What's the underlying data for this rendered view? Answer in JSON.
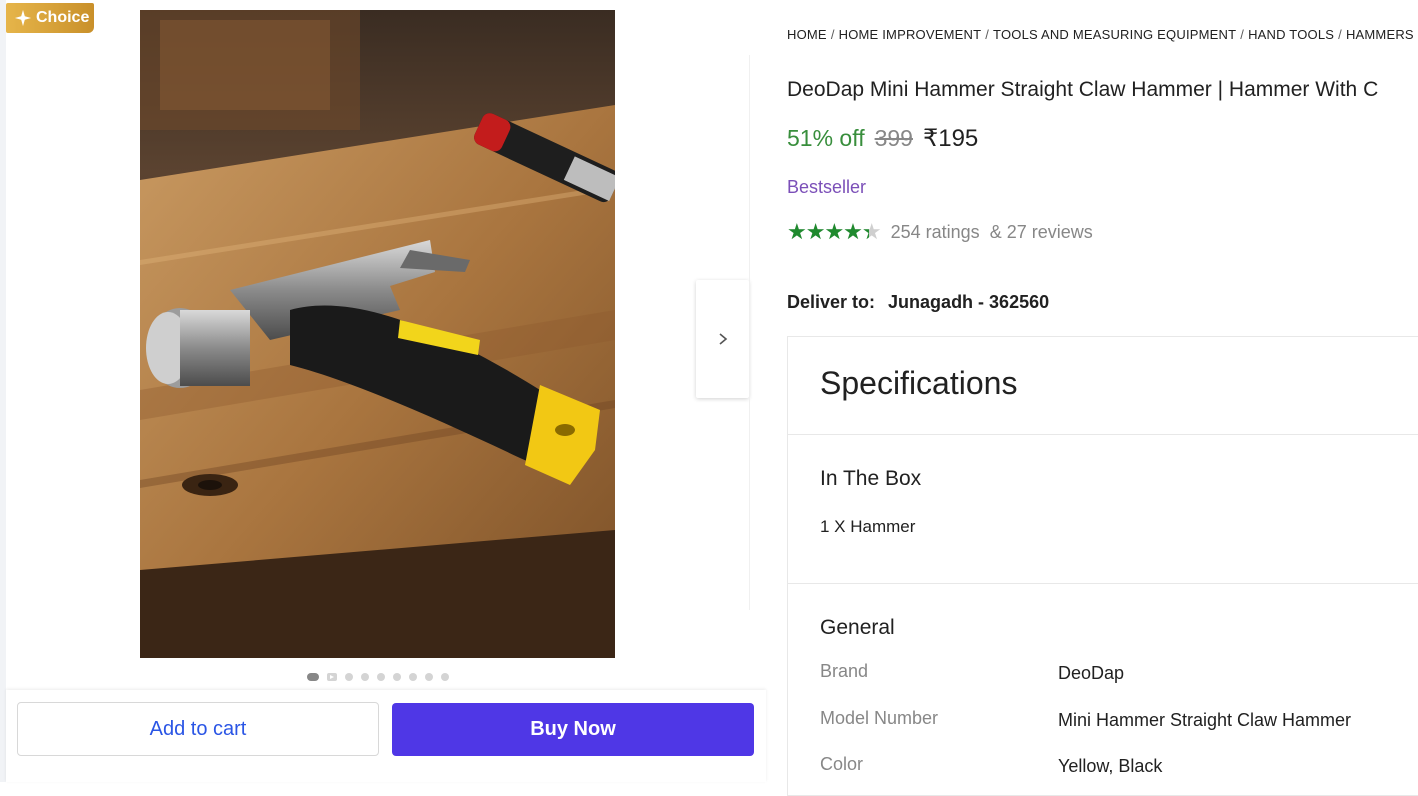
{
  "badge": {
    "label": "Choice"
  },
  "gallery": {
    "image_count": 9,
    "active_index": 0
  },
  "actions": {
    "add_to_cart": "Add to cart",
    "buy_now": "Buy Now"
  },
  "breadcrumb": [
    "HOME",
    "HOME IMPROVEMENT",
    "TOOLS AND MEASURING EQUIPMENT",
    "HAND TOOLS",
    "HAMMERS"
  ],
  "product": {
    "title": "DeoDap Mini Hammer Straight Claw Hammer | Hammer With C",
    "discount": "51% off",
    "mrp": "399",
    "price": "₹195",
    "tag": "Bestseller",
    "rating": 4.4,
    "rating_max": 5,
    "ratings_text": "254 ratings",
    "reviews_text": "& 27 reviews"
  },
  "delivery": {
    "label": "Deliver to:",
    "location": "Junagadh - 362560"
  },
  "specifications": {
    "title": "Specifications",
    "in_the_box": {
      "title": "In The Box",
      "value": "1 X Hammer"
    },
    "general": {
      "title": "General",
      "rows": [
        {
          "key": "Brand",
          "value": "DeoDap"
        },
        {
          "key": "Model Number",
          "value": "Mini Hammer Straight Claw Hammer"
        },
        {
          "key": "Color",
          "value": "Yellow, Black"
        }
      ]
    }
  },
  "colors": {
    "accent": "#4f37e6",
    "discount": "#388e3c",
    "bestseller": "#7b4fb8",
    "star": "#1f8a2e"
  }
}
